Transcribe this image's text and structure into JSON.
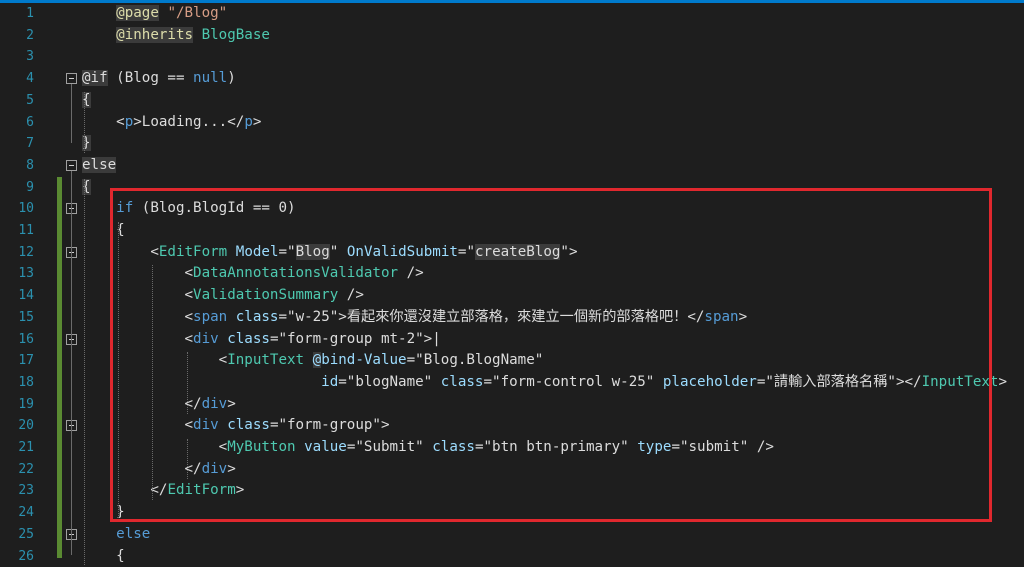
{
  "editor": {
    "lines": [
      {
        "n": "1",
        "tokens": [
          {
            "t": "    "
          },
          {
            "t": "@page",
            "c": "dir"
          },
          {
            "t": " "
          },
          {
            "t": "\"/Blog\"",
            "c": "str"
          }
        ]
      },
      {
        "n": "2",
        "tokens": [
          {
            "t": "    "
          },
          {
            "t": "@inherits",
            "c": "dir"
          },
          {
            "t": " "
          },
          {
            "t": "BlogBase",
            "c": "comp"
          }
        ]
      },
      {
        "n": "3",
        "tokens": []
      },
      {
        "n": "4",
        "tokens": [
          {
            "t": "@if",
            "c": "razor"
          },
          {
            "t": " (Blog == ",
            "c": "pl"
          },
          {
            "t": "null",
            "c": "kw"
          },
          {
            "t": ")",
            "c": "pl"
          }
        ]
      },
      {
        "n": "5",
        "tokens": [
          {
            "t": "{",
            "c": "razor"
          }
        ]
      },
      {
        "n": "6",
        "tokens": [
          {
            "t": "    "
          },
          {
            "t": "<",
            "c": "pl"
          },
          {
            "t": "p",
            "c": "tag"
          },
          {
            "t": ">Loading...</",
            "c": "pl"
          },
          {
            "t": "p",
            "c": "tag"
          },
          {
            "t": ">",
            "c": "pl"
          }
        ]
      },
      {
        "n": "7",
        "tokens": [
          {
            "t": "}",
            "c": "razor"
          }
        ]
      },
      {
        "n": "8",
        "tokens": [
          {
            "t": "else",
            "c": "razor"
          }
        ]
      },
      {
        "n": "9",
        "tokens": [
          {
            "t": "{",
            "c": "razor"
          }
        ]
      },
      {
        "n": "10",
        "tokens": [
          {
            "t": "    "
          },
          {
            "t": "if",
            "c": "kw"
          },
          {
            "t": " (Blog.BlogId == 0)",
            "c": "pl"
          }
        ]
      },
      {
        "n": "11",
        "tokens": [
          {
            "t": "    {",
            "c": "pl"
          }
        ]
      },
      {
        "n": "12",
        "tokens": [
          {
            "t": "        "
          },
          {
            "t": "<",
            "c": "pl"
          },
          {
            "t": "EditForm",
            "c": "comp"
          },
          {
            "t": " "
          },
          {
            "t": "Model",
            "c": "attr"
          },
          {
            "t": "=\"",
            "c": "pl"
          },
          {
            "t": "Blog",
            "c": "razor"
          },
          {
            "t": "\" ",
            "c": "pl"
          },
          {
            "t": "OnValidSubmit",
            "c": "attr"
          },
          {
            "t": "=\"",
            "c": "pl"
          },
          {
            "t": "createBlog",
            "c": "razor"
          },
          {
            "t": "\">",
            "c": "pl"
          }
        ]
      },
      {
        "n": "13",
        "tokens": [
          {
            "t": "            "
          },
          {
            "t": "<",
            "c": "pl"
          },
          {
            "t": "DataAnnotationsValidator",
            "c": "comp"
          },
          {
            "t": " />",
            "c": "pl"
          }
        ]
      },
      {
        "n": "14",
        "tokens": [
          {
            "t": "            "
          },
          {
            "t": "<",
            "c": "pl"
          },
          {
            "t": "ValidationSummary",
            "c": "comp"
          },
          {
            "t": " />",
            "c": "pl"
          }
        ]
      },
      {
        "n": "15",
        "tokens": [
          {
            "t": "            "
          },
          {
            "t": "<",
            "c": "pl"
          },
          {
            "t": "span",
            "c": "tag"
          },
          {
            "t": " "
          },
          {
            "t": "class",
            "c": "attr"
          },
          {
            "t": "=\"w-25\">看起來你還沒建立部落格，來建立一個新的部落格吧！</",
            "c": "pl"
          },
          {
            "t": "span",
            "c": "tag"
          },
          {
            "t": ">",
            "c": "pl"
          }
        ]
      },
      {
        "n": "16",
        "tokens": [
          {
            "t": "            "
          },
          {
            "t": "<",
            "c": "pl"
          },
          {
            "t": "div",
            "c": "tag"
          },
          {
            "t": " "
          },
          {
            "t": "class",
            "c": "attr"
          },
          {
            "t": "=\"form-group mt-2\">|",
            "c": "pl"
          }
        ]
      },
      {
        "n": "17",
        "tokens": [
          {
            "t": "                "
          },
          {
            "t": "<",
            "c": "pl"
          },
          {
            "t": "InputText",
            "c": "comp"
          },
          {
            "t": " "
          },
          {
            "t": "@",
            "c": "bind"
          },
          {
            "t": "bind-Value",
            "c": "attr"
          },
          {
            "t": "=\"Blog.BlogName\"",
            "c": "pl"
          }
        ]
      },
      {
        "n": "18",
        "tokens": [
          {
            "t": "                            "
          },
          {
            "t": "id",
            "c": "attr"
          },
          {
            "t": "=\"blogName\" ",
            "c": "pl"
          },
          {
            "t": "class",
            "c": "attr"
          },
          {
            "t": "=\"form-control w-25\" ",
            "c": "pl"
          },
          {
            "t": "placeholder",
            "c": "attr"
          },
          {
            "t": "=\"請輸入部落格名稱\"></",
            "c": "pl"
          },
          {
            "t": "InputText",
            "c": "comp"
          },
          {
            "t": ">",
            "c": "pl"
          }
        ]
      },
      {
        "n": "19",
        "tokens": [
          {
            "t": "            "
          },
          {
            "t": "</",
            "c": "pl"
          },
          {
            "t": "div",
            "c": "tag"
          },
          {
            "t": ">",
            "c": "pl"
          }
        ]
      },
      {
        "n": "20",
        "tokens": [
          {
            "t": "            "
          },
          {
            "t": "<",
            "c": "pl"
          },
          {
            "t": "div",
            "c": "tag"
          },
          {
            "t": " "
          },
          {
            "t": "class",
            "c": "attr"
          },
          {
            "t": "=\"form-group\">",
            "c": "pl"
          }
        ]
      },
      {
        "n": "21",
        "tokens": [
          {
            "t": "                "
          },
          {
            "t": "<",
            "c": "pl"
          },
          {
            "t": "MyButton",
            "c": "comp"
          },
          {
            "t": " "
          },
          {
            "t": "value",
            "c": "attr"
          },
          {
            "t": "=\"Submit\" ",
            "c": "pl"
          },
          {
            "t": "class",
            "c": "attr"
          },
          {
            "t": "=\"btn btn-primary\" ",
            "c": "pl"
          },
          {
            "t": "type",
            "c": "attr"
          },
          {
            "t": "=\"submit\" />",
            "c": "pl"
          }
        ]
      },
      {
        "n": "22",
        "tokens": [
          {
            "t": "            "
          },
          {
            "t": "</",
            "c": "pl"
          },
          {
            "t": "div",
            "c": "tag"
          },
          {
            "t": ">",
            "c": "pl"
          }
        ]
      },
      {
        "n": "23",
        "tokens": [
          {
            "t": "        "
          },
          {
            "t": "</",
            "c": "pl"
          },
          {
            "t": "EditForm",
            "c": "comp"
          },
          {
            "t": ">",
            "c": "pl"
          }
        ]
      },
      {
        "n": "24",
        "tokens": [
          {
            "t": "    }",
            "c": "pl"
          }
        ]
      },
      {
        "n": "25",
        "tokens": [
          {
            "t": "    "
          },
          {
            "t": "else",
            "c": "kw"
          }
        ]
      },
      {
        "n": "26",
        "tokens": [
          {
            "t": "    {",
            "c": "pl"
          }
        ]
      }
    ],
    "fold_markers": [
      "4",
      "8",
      "10",
      "12",
      "16",
      "20",
      "25"
    ],
    "colors": {
      "background": "#1e1e1e",
      "line_number": "#2b91af",
      "keyword": "#569cd6",
      "string": "#d69d85",
      "component": "#4ec9b0",
      "attribute": "#9cdcfe",
      "highlight_box": "#e0282e",
      "change_bar": "#5a8a32"
    }
  }
}
